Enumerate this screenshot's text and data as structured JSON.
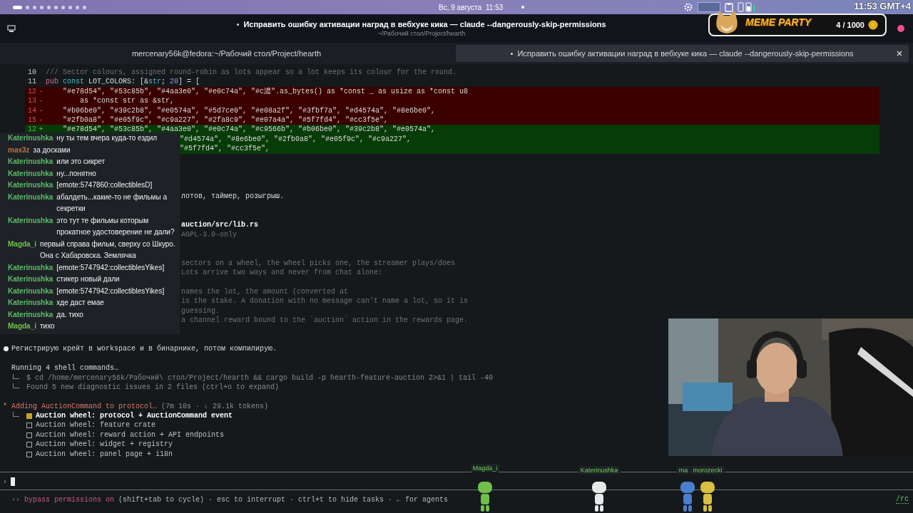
{
  "top_panel": {
    "workspaces": [
      {
        "selected": true
      },
      {
        "selected": false
      },
      {
        "selected": false
      },
      {
        "selected": false
      },
      {
        "selected": false
      },
      {
        "selected": false
      },
      {
        "selected": false
      },
      {
        "selected": false
      },
      {
        "selected": false
      },
      {
        "selected": false
      }
    ],
    "date": "Вс, 9 августа",
    "time": "11:53",
    "clock": "11:53 GMT+4"
  },
  "window": {
    "activity": true,
    "title": "Исправить ошибку активации наград в вебхуке кика — claude --dangerously-skip-permissions",
    "subtitle": "~/Рабочий стол/Project/hearth"
  },
  "tabs": [
    {
      "label": "mercenary56k@fedora:~/Рабочий стол/Project/hearth",
      "selected": false,
      "activity": false
    },
    {
      "label": "Исправить ошибку активации наград в вебхуке кика — claude --dangerously-skip-permissions",
      "selected": true,
      "activity": true
    }
  ],
  "widget": {
    "title": "MEME PARTY",
    "count": "4 / 1000"
  },
  "terminal": {
    "rows": [
      {
        "kind": "code",
        "num": "10",
        "parts": [
          {
            "kind": "comment",
            "text": "/// Sector colours, assigned round-robin as lots appear so a lot keeps its colour for the round."
          }
        ]
      },
      {
        "kind": "code",
        "num": "11",
        "parts": [
          {
            "kind": "keyword",
            "text": "pub"
          },
          {
            "kind": "decl",
            "text": " const"
          },
          {
            "kind": "plain",
            "text": " LOT_COLORS: [&"
          },
          {
            "kind": "type",
            "text": "str"
          },
          {
            "kind": "plain",
            "text": "; "
          },
          {
            "kind": "number",
            "text": "20"
          },
          {
            "kind": "plain",
            "text": "] = ["
          }
        ]
      },
      {
        "kind": "del",
        "num": "12",
        "sign": "-",
        "parts": [
          {
            "kind": "plain",
            "text": "    \"#e78d54\", \"#53c85b\", \"#4aa3e0\", \"#e0c74a\", \"#c濃\".as_bytes() as *const _ as usize as *const u8"
          }
        ]
      },
      {
        "kind": "del",
        "num": "13",
        "sign": "-",
        "parts": [
          {
            "kind": "plain",
            "text": "        as *const str as &str,"
          }
        ]
      },
      {
        "kind": "del",
        "num": "14",
        "sign": "-",
        "parts": [
          {
            "kind": "plain",
            "text": "    \"#b06be0\", \"#39c2b8\", \"#e0574a\", \"#5d7ce0\", \"#e08a2f\", \"#3fbf7a\", \"#d4574a\", \"#8e6be0\","
          }
        ]
      },
      {
        "kind": "del",
        "num": "15",
        "sign": "-",
        "parts": [
          {
            "kind": "plain",
            "text": "    \"#2fb0a8\", \"#e05f9c\", \"#c9a227\", \"#2fa8c9\", \"#e07a4a\", \"#5f7fd4\", \"#cc3f5e\","
          }
        ]
      },
      {
        "kind": "add",
        "num": "12",
        "sign": "+",
        "parts": [
          {
            "kind": "plain",
            "text": "    \"#e78d54\", \"#53c85b\", \"#4aa3e0\", \"#e0c74a\", \"#c9566b\", \"#b06be0\", \"#39c2b8\", \"#e0574a\","
          }
        ]
      },
      {
        "kind": "add",
        "covered": true,
        "parts": [
          {
            "kind": "plain",
            "text": "\"#d4574a\", \"#8e6be0\", \"#2fb0a8\", \"#e05f9c\", \"#c9a227\","
          }
        ]
      },
      {
        "kind": "add",
        "covered": true,
        "parts": [
          {
            "kind": "plain",
            "text": "\"#5f7fd4\", \"#cc3f5e\","
          }
        ]
      },
      {
        "kind": "blank"
      },
      {
        "kind": "blank"
      },
      {
        "kind": "blank"
      },
      {
        "kind": "blank"
      },
      {
        "kind": "note",
        "text": "лотов, таймер, розыгрыш."
      },
      {
        "kind": "blank"
      },
      {
        "kind": "blank"
      },
      {
        "kind": "path",
        "text": "auction/src/lib.rs"
      },
      {
        "kind": "remark",
        "text": "AGPL-3.0-only"
      },
      {
        "kind": "blank"
      },
      {
        "kind": "blank"
      },
      {
        "kind": "remark",
        "text": "sectors on a wheel, the wheel picks one, the streamer plays/does"
      },
      {
        "kind": "remark",
        "text": "Lots arrive two ways and never from chat alone:"
      },
      {
        "kind": "blank"
      },
      {
        "kind": "remark",
        "text": "names the lot, the amount (converted at"
      },
      {
        "kind": "remark",
        "text": "is the stake. A donation with no message can't name a lot, so it is"
      },
      {
        "kind": "remark",
        "text": "guessing."
      },
      {
        "kind": "remark",
        "text": "a channel reward bound to the `auction` action in the rewards page."
      },
      {
        "kind": "blank"
      },
      {
        "kind": "blank"
      },
      {
        "kind": "bullet",
        "text": "Регистрирую крейт в workspace и в бинарнике, потом компилирую."
      },
      {
        "kind": "blank"
      },
      {
        "kind": "plain",
        "text": "Running 4 shell commands…"
      },
      {
        "kind": "tree",
        "text": "$ cd /home/mercenary56k/Рабочий\\ стол/Project/hearth && cargo build -p hearth-feature-auction 2>&1 | tail -40"
      },
      {
        "kind": "tree",
        "text": "Found 5 new diagnostic issues in 2 files (ctrl+o to expand)"
      },
      {
        "kind": "blank"
      },
      {
        "kind": "status",
        "spinner": "*",
        "text": "Adding AuctionCommand to protocol…",
        "detail": "(7m 10s · ↓ 29.1k tokens)"
      },
      {
        "kind": "task",
        "text": "Auction wheel: protocol + AuctionCommand event",
        "in_progress": true
      },
      {
        "kind": "task",
        "text": "Auction wheel: feature crate",
        "in_progress": false
      },
      {
        "kind": "task",
        "text": "Auction wheel: reward action + API endpoints",
        "in_progress": false
      },
      {
        "kind": "task",
        "text": "Auction wheel: widget + registry",
        "in_progress": false
      },
      {
        "kind": "task",
        "text": "Auction wheel: panel page + i18n",
        "in_progress": false
      }
    ],
    "prompt": "›",
    "footer": {
      "mode": "›› bypass permissions on",
      "hint": "(shift+tab to cycle) · esc to interrupt · ctrl+t to hide tasks · ← for agents",
      "command": "/rc"
    }
  },
  "chat": [
    {
      "user": "Katerinushka",
      "color": "#5dbb6a",
      "text": "ну ты тем вчера куда-то ездил"
    },
    {
      "user": "max3z",
      "color": "#b8733f",
      "text": "за досками"
    },
    {
      "user": "Katerinushka",
      "color": "#5dbb6a",
      "text": "или это сикрет"
    },
    {
      "user": "Katerinushka",
      "color": "#5dbb6a",
      "text": "ну...понятно"
    },
    {
      "user": "Katerinushka",
      "color": "#5dbb6a",
      "text": "[emote:5747860:collectiblesD]"
    },
    {
      "user": "Katerinushka",
      "color": "#5dbb6a",
      "text": "абалдеть...какие-то не фильмы а секретки"
    },
    {
      "user": "Katerinushka",
      "color": "#5dbb6a",
      "text": "это тут те фильмы которым прокатное удостоверение не дали?"
    },
    {
      "user": "Magda_i",
      "color": "#6fc24a",
      "text": "первый справа фильм, сверху со Шкуро. Она с Хабаровска. Землячка"
    },
    {
      "user": "Katerinushka",
      "color": "#5dbb6a",
      "text": "[emote:5747942:collectiblesYikes]"
    },
    {
      "user": "Katerinushka",
      "color": "#5dbb6a",
      "text": "стикер новый дали"
    },
    {
      "user": "Katerinushka",
      "color": "#5dbb6a",
      "text": "[emote:5747942:collectiblesYikes]"
    },
    {
      "user": "Katerinushka",
      "color": "#5dbb6a",
      "text": "хде даст емае"
    },
    {
      "user": "Katerinushka",
      "color": "#5dbb6a",
      "text": "да. тихо"
    },
    {
      "user": "Magda_i",
      "color": "#6fc24a",
      "text": "тихо"
    }
  ],
  "mascots": [
    {
      "name": "Magda_i",
      "color": "#6fbf4a"
    },
    {
      "name": "Katerinushka",
      "color": "#e8e8e8"
    },
    {
      "name": "ma",
      "color": "#4a7fd0"
    },
    {
      "name": "morozecki",
      "color": "#d8c040"
    }
  ]
}
